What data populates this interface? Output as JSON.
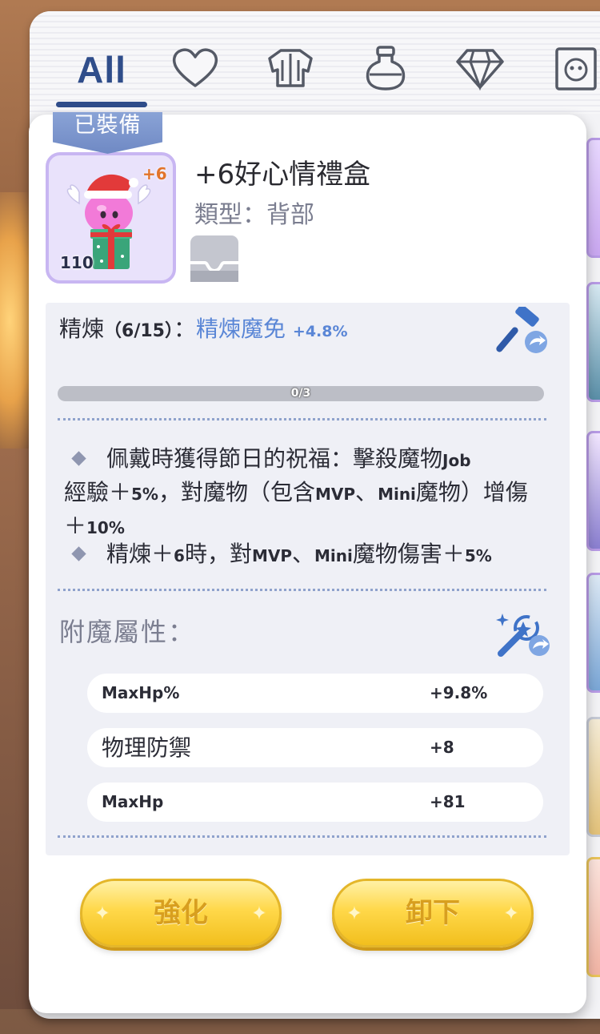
{
  "tabs": {
    "all_label": "All",
    "icons": [
      "heart-icon",
      "armor-icon",
      "potion-icon",
      "diamond-icon",
      "card-icon"
    ]
  },
  "item": {
    "equipped_label": "已裝備",
    "name": "+6好心情禮盒",
    "type": "類型：背部",
    "level": "110",
    "refine_badge": "+6",
    "slot_icon": "empty-card-slot-icon"
  },
  "refine": {
    "label": "精煉",
    "count": "（6/15）",
    "colon": "：",
    "name": "精煉魔免",
    "bonus": "+4.8%",
    "progress_text": "0/3",
    "progress_value": 0.0
  },
  "effects": {
    "line1_a": "佩戴時獲得節日的祝福：擊殺魔物",
    "line1_b": "Job",
    "line1_c": "經驗＋",
    "line1_d": "5%",
    "line1_e": "，對魔物（包含",
    "line1_f": "MVP",
    "line1_g": "、",
    "line1_h": "Mini",
    "line1_i": "魔物）增傷＋",
    "line1_j": "10%",
    "line2_a": "精煉＋",
    "line2_b": "6",
    "line2_c": "時，對",
    "line2_d": "MVP",
    "line2_e": "、",
    "line2_f": "Mini",
    "line2_g": "魔物傷害＋",
    "line2_h": "5%"
  },
  "enchant": {
    "label": "附魔屬性：",
    "attributes": [
      {
        "name": "MaxHp%",
        "value": "+9.8%"
      },
      {
        "name": "物理防禦",
        "value": "+8"
      },
      {
        "name": "MaxHp",
        "value": "+81"
      }
    ]
  },
  "buttons": {
    "enhance": "強化",
    "unequip": "卸下"
  },
  "colors": {
    "accent_blue": "#2f4d8a",
    "refine_blue": "#5a86d6",
    "button_gold": "#ffd84a",
    "refine_orange": "#e2742a"
  }
}
